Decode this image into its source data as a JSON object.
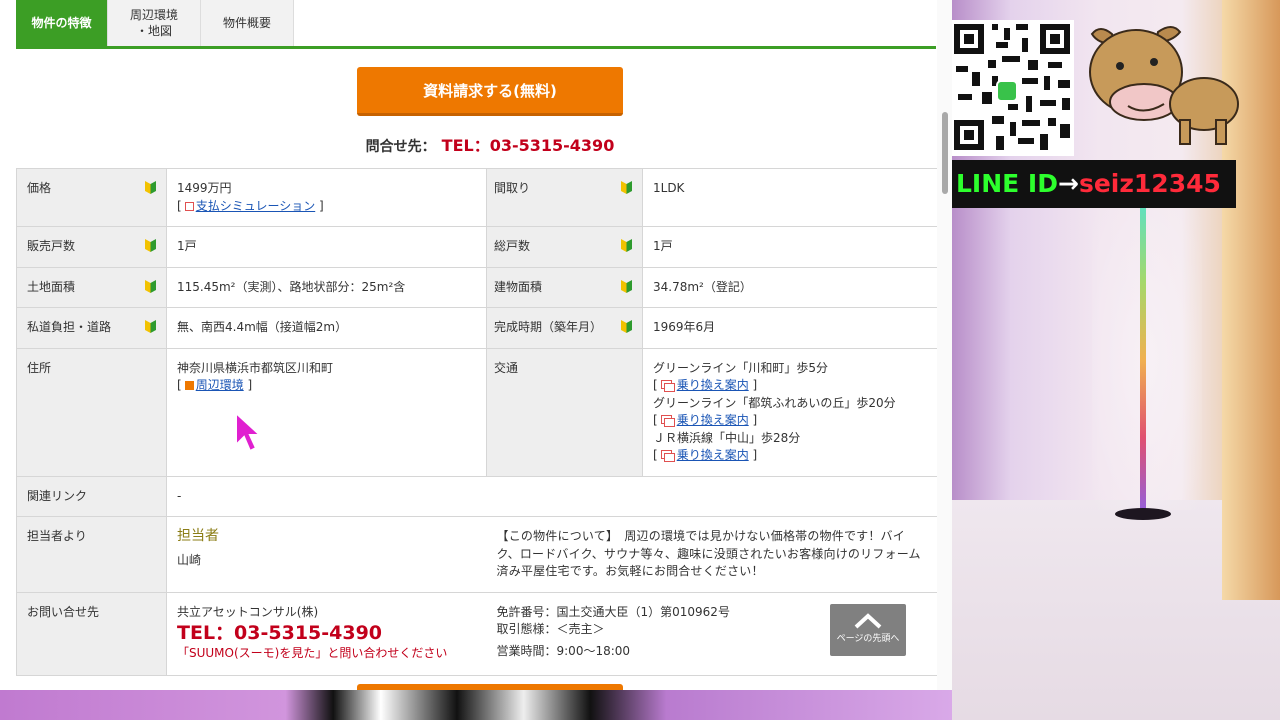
{
  "tabs": [
    {
      "label": "物件の特徴"
    },
    {
      "label": "周辺環境\n・地図"
    },
    {
      "label": "物件概要"
    }
  ],
  "cta": {
    "label": "資料請求する(無料)"
  },
  "contact": {
    "prefix": "問合せ先：",
    "tel": "TEL：03-5315-4390"
  },
  "spec": {
    "price_label": "価格",
    "price_value": "1499万円",
    "price_link": "支払シミュレーション",
    "layout_label": "間取り",
    "layout_value": "1LDK",
    "units_sale_label": "販売戸数",
    "units_sale_value": "1戸",
    "units_total_label": "総戸数",
    "units_total_value": "1戸",
    "land_label": "土地面積",
    "land_value": "115.45m²（実測）、路地状部分：25m²含",
    "building_label": "建物面積",
    "building_value": "34.78m²（登記）",
    "road_label": "私道負担・道路",
    "road_value": "無、南西4.4m幅（接道幅2m）",
    "built_label": "完成時期（築年月）",
    "built_value": "1969年6月",
    "address_label": "住所",
    "address_value": "神奈川県横浜市都筑区川和町",
    "address_link": "周辺環境",
    "transport_label": "交通",
    "transport": [
      {
        "line": "グリーンライン「川和町」歩5分",
        "link": "乗り換え案内"
      },
      {
        "line": "グリーンライン「都筑ふれあいの丘」歩20分",
        "link": "乗り換え案内"
      },
      {
        "line": "ＪＲ横浜線「中山」歩28分",
        "link": "乗り換え案内"
      }
    ],
    "related_label": "関連リンク",
    "related_value": "-",
    "staff_label": "担当者より",
    "staff_title": "担当者",
    "staff_name": "山崎",
    "staff_comment": "【この物件について】　周辺の環境では見かけない価格帯の物件です！バイク、ロードバイク、サウナ等々、趣味に没頭されたいお客様向けのリフォーム済み平屋住宅です。お気軽にお問合せください！",
    "inquiry_label": "お問い合せ先",
    "company": "共立アセットコンサル(株)",
    "inquiry_tel": "TEL：03-5315-4390",
    "inquiry_note": "「SUUMO(スーモ)を見た」と問い合わせください",
    "license": "免許番号：国土交通大臣（1）第010962号",
    "trade": "取引態様：＜売主＞",
    "hours": "営業時間：9:00～18:00"
  },
  "page_top": {
    "label": "ページの先頭へ"
  },
  "overlay": {
    "line_id_prefix": "LINE ID",
    "arrow": "→",
    "line_id": "seiz12345"
  },
  "colors": {
    "accent_green": "#3c9e25",
    "cta_orange": "#ee7800",
    "tel_red": "#c2001b"
  }
}
